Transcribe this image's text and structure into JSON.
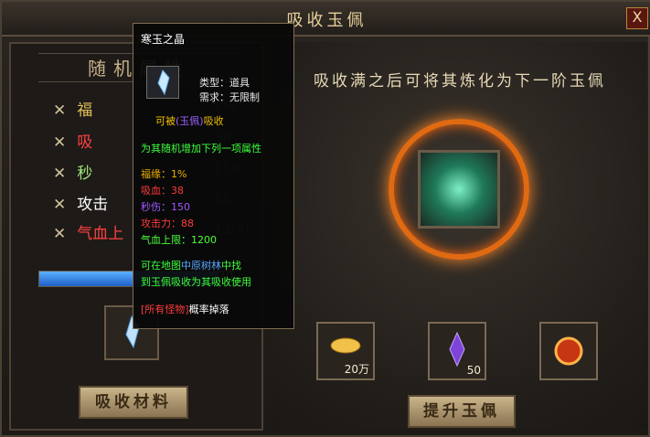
{
  "window": {
    "title": "吸收玉佩",
    "close_label": "X"
  },
  "left": {
    "header": "随机属性",
    "attributes": [
      {
        "name": "福",
        "value": "1%",
        "color": "#e7c25a"
      },
      {
        "name": "吸",
        "value": "38",
        "color": "#ff4242"
      },
      {
        "name": "秒",
        "value": "150",
        "color": "#9d5cff"
      },
      {
        "name": "攻击",
        "value": "88",
        "color": "#ffffff"
      },
      {
        "name": "气血上",
        "value": "1200",
        "color": "#ff4242"
      }
    ],
    "progress": {
      "label": "20",
      "fraction": 0.9
    },
    "absorb_button": "吸收材料"
  },
  "main": {
    "hint": "吸收满之后可将其炼化为下一阶玉佩",
    "items": [
      {
        "icon": "gold-ingot-icon",
        "count": "20万"
      },
      {
        "icon": "purple-crystal-icon",
        "count": "50"
      },
      {
        "icon": "fire-orb-icon",
        "count": ""
      }
    ],
    "upgrade_button": "提升玉佩"
  },
  "tooltip": {
    "name": "寒玉之晶",
    "type": "类型：道具",
    "require": "需求：无限制",
    "absorbable_prefix": "可被",
    "absorbable_target": "(玉佩)",
    "absorbable_suffix": "吸收",
    "desc": "为其随机增加下列一项属性",
    "stats": [
      {
        "text": "福缘：1%",
        "color": "#f0b000"
      },
      {
        "text": "吸血：38",
        "color": "#ff3c3c"
      },
      {
        "text": "秒伤：150",
        "color": "#a158ff"
      },
      {
        "text": "攻击力：88",
        "color": "#ff3c3c"
      },
      {
        "text": "气血上限：1200",
        "color": "#4cff3c"
      }
    ],
    "loc_prefix": "可在地图",
    "loc_name": "中原树林",
    "loc_suffix": "中找",
    "loc_line2": "到玉佩吸收为其吸收使用",
    "drop_prefix": "[所有怪物]",
    "drop_suffix": "概率掉落"
  }
}
